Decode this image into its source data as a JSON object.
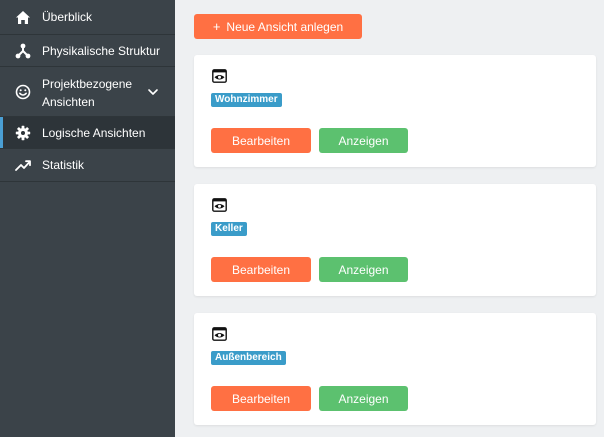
{
  "sidebar": {
    "items": [
      {
        "label": "Überblick",
        "icon": "home-icon"
      },
      {
        "label": "Physikalische Struktur",
        "icon": "network-icon"
      },
      {
        "label_line1": "Projektbezogene",
        "label_line2": "Ansichten",
        "icon": "smiley-icon"
      },
      {
        "label": "Logische Ansichten",
        "icon": "gear-icon",
        "active": true
      },
      {
        "label": "Statistik",
        "icon": "trending-up-icon"
      }
    ]
  },
  "main": {
    "add_button": {
      "plus": "+",
      "label": "Neue Ansicht anlegen"
    },
    "cards": [
      {
        "badge": "Wohnzimmer",
        "edit_label": "Bearbeiten",
        "show_label": "Anzeigen"
      },
      {
        "badge": "Keller",
        "edit_label": "Bearbeiten",
        "show_label": "Anzeigen"
      },
      {
        "badge": "Außenbereich",
        "edit_label": "Bearbeiten",
        "show_label": "Anzeigen"
      }
    ]
  },
  "colors": {
    "sidebar_bg": "#3b4349",
    "accent_orange": "#ff7043",
    "accent_green": "#5cc16f",
    "badge_blue": "#3a9cc9",
    "active_marker": "#4a9fd4"
  }
}
